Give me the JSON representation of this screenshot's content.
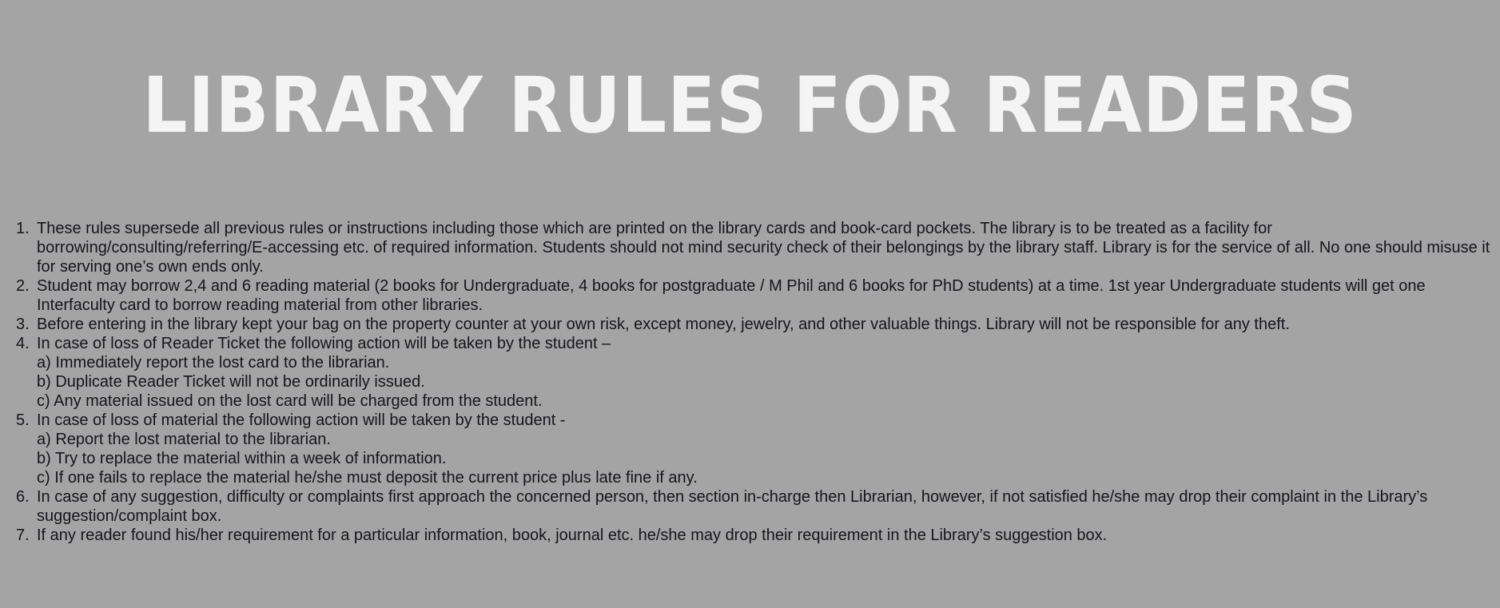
{
  "title": "LIBRARY RULES FOR READERS",
  "rules": [
    {
      "num": "1.",
      "text": "These rules supersede all previous rules or instructions including those which are printed on the library cards and book-card pockets. The library is to be treated as a facility for borrowing/consulting/referring/E-accessing etc. of required information. Students should not mind security check of their belongings by the library staff. Library is for the service of all. No one should misuse it for serving one’s own ends only.",
      "subs": []
    },
    {
      "num": "2.",
      "text": "Student may borrow 2,4 and 6 reading material (2 books for Undergraduate, 4 books for postgraduate / M Phil and 6 books for PhD students) at a time. 1st year Undergraduate students will get one Interfaculty card to borrow reading material from other libraries.",
      "subs": []
    },
    {
      "num": "3.",
      "text": "Before entering in the library kept your bag on the property counter at your own risk, except money, jewelry, and other valuable things. Library will not be responsible for any theft.",
      "subs": []
    },
    {
      "num": "4.",
      "text": "In case of loss of Reader Ticket the following action will be taken by the student –",
      "subs": [
        "a) Immediately report the lost card to the librarian.",
        "b) Duplicate Reader Ticket will not be ordinarily issued.",
        "c) Any material issued on the lost card will be charged from the student."
      ]
    },
    {
      "num": "5.",
      "text": "In case of loss of material the following action will be taken by the student -",
      "subs": [
        "a) Report the lost material to the librarian.",
        "b) Try to replace the material within a week of information.",
        "c) If one fails to replace the material he/she must deposit the current price plus late fine if any."
      ]
    },
    {
      "num": "6.",
      "text": "In case of any suggestion, difficulty or complaints first approach the concerned person, then section in-charge then Librarian, however, if not satisfied he/she may drop their complaint in the Library’s suggestion/complaint box.",
      "subs": []
    },
    {
      "num": "7.",
      "text": "If any reader found his/her requirement for a particular information, book, journal etc. he/she may drop their requirement in the Library’s suggestion box.",
      "subs": []
    }
  ]
}
